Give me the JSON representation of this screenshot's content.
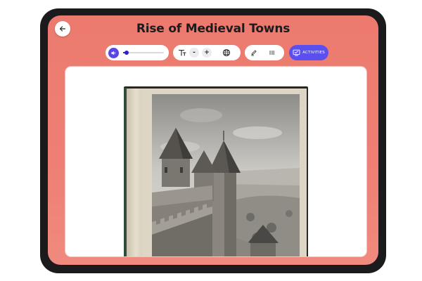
{
  "header": {
    "title": "Rise of Medieval Towns"
  },
  "toolbar": {
    "audio": {
      "progress": 0.08
    },
    "text_tools": {
      "decrease_label": "-",
      "increase_label": "+"
    },
    "activities_label": "ACTIVITIES"
  },
  "content": {
    "image_subject": "castle-photograph"
  },
  "colors": {
    "screen_bg": "#ec7a6f",
    "accent": "#5b50ef",
    "play_button": "#5a45e6",
    "device_frame": "#1b1b1d"
  },
  "icons": {
    "back": "arrow-left-icon",
    "audio": "speaker-icon",
    "text_size": "text-size-icon",
    "language": "globe-icon",
    "highlight": "pen-icon",
    "list": "list-icon",
    "activities": "activities-icon"
  }
}
